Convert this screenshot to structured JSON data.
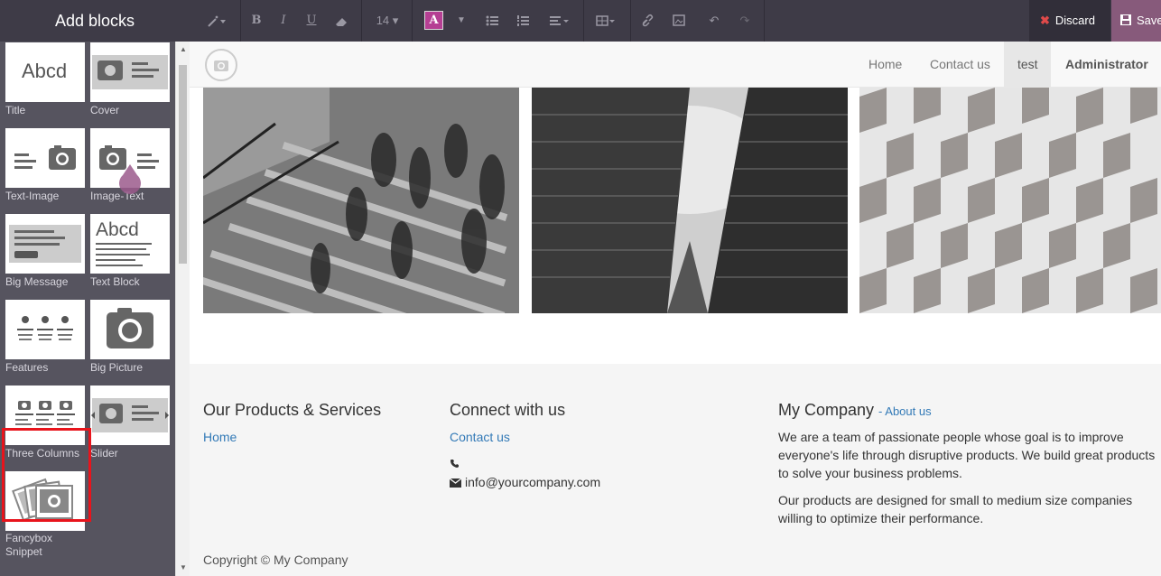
{
  "sidebar": {
    "title": "Add blocks",
    "blocks": [
      {
        "label": "Title"
      },
      {
        "label": "Cover"
      },
      {
        "label": "Text-Image"
      },
      {
        "label": "Image-Text"
      },
      {
        "label": "Big Message"
      },
      {
        "label": "Text Block"
      },
      {
        "label": "Features"
      },
      {
        "label": "Big Picture"
      },
      {
        "label": "Three Columns"
      },
      {
        "label": "Slider"
      },
      {
        "label": "Fancybox Snippet"
      }
    ],
    "thumb_text": "Abcd"
  },
  "toolbar": {
    "font_size": "14",
    "discard_label": "Discard",
    "save_label": "Save",
    "accent_color": "#875a7b",
    "icons": [
      "magic-wand-icon",
      "bold-icon",
      "italic-icon",
      "underline-icon",
      "eraser-icon",
      "font-size-select",
      "font-color-icon",
      "color-dropdown-icon",
      "bullet-list-icon",
      "numbered-list-icon",
      "align-icon",
      "table-icon",
      "link-icon",
      "image-icon",
      "undo-icon",
      "redo-icon"
    ]
  },
  "navbar": {
    "links": [
      {
        "label": "Home"
      },
      {
        "label": "Contact us"
      },
      {
        "label": "test"
      },
      {
        "label": "Administrator"
      }
    ]
  },
  "footer": {
    "col1": {
      "heading": "Our Products & Services",
      "link": "Home"
    },
    "col2": {
      "heading": "Connect with us",
      "link": "Contact us",
      "email": "info@yourcompany.com"
    },
    "col3": {
      "heading": "My Company",
      "heading_link": "- About us",
      "p1": "We are a team of passionate people whose goal is to improve everyone's life through disruptive products. We build great products to solve your business problems.",
      "p2": "Our products are designed for small to medium size companies willing to optimize their performance."
    },
    "copyright": "Copyright © My Company"
  }
}
